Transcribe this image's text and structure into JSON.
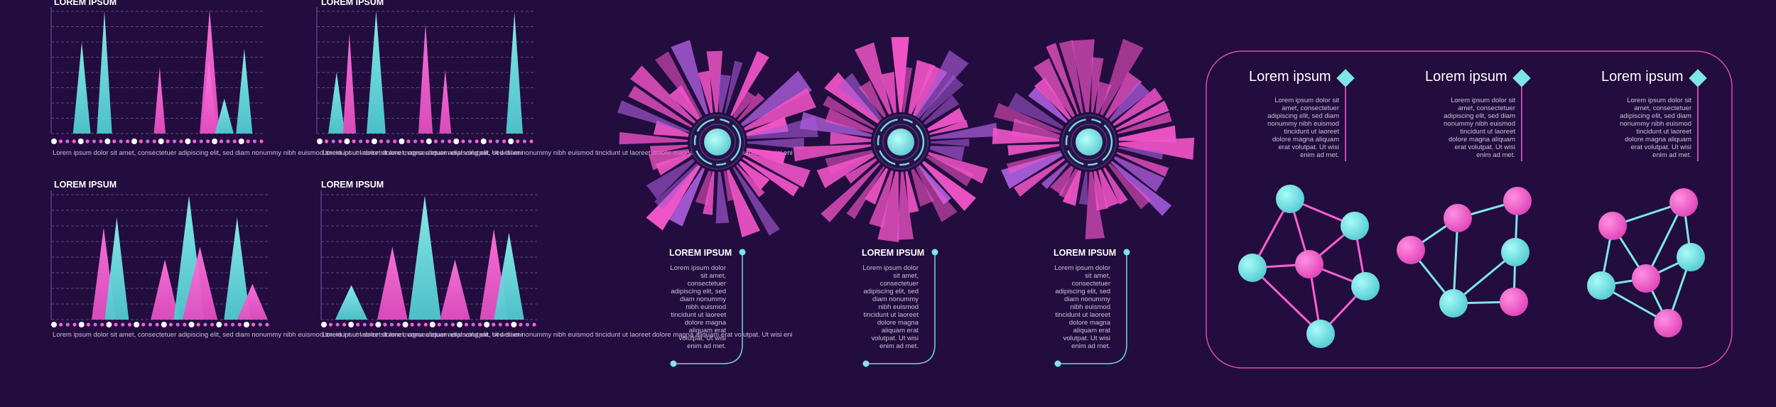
{
  "colors": {
    "background": "#230c3e",
    "cyan": "#7fe6e6",
    "magenta": "#ff5fcf",
    "grid": "#5a4a86",
    "panel_border": "#d64fb0"
  },
  "chart_data": [
    {
      "type": "area",
      "title": "LOREM IPSUM",
      "series": [
        {
          "name": "",
          "peaks": [
            {
              "c": 0.46,
              "h": 0.73,
              "w": 0.15,
              "color": "cyan"
            },
            {
              "c": 0.8,
              "h": 0.98,
              "w": 0.13,
              "color": "cyan"
            },
            {
              "c": 1.63,
              "h": 0.53,
              "w": 0.1,
              "color": "magenta"
            },
            {
              "c": 2.38,
              "h": 0.99,
              "w": 0.17,
              "color": "magenta"
            },
            {
              "c": 2.37,
              "h": 0.58,
              "w": 0.14,
              "color": "magenta"
            },
            {
              "c": 2.6,
              "h": 0.28,
              "w": 0.16,
              "color": "cyan"
            },
            {
              "c": 2.9,
              "h": 0.68,
              "w": 0.14,
              "color": "cyan"
            }
          ]
        }
      ],
      "caption": "Lorem ipsum dolor sit amet, consectetuer adipiscing elit, sed diam nonummy nibh euismod tincidunt ut laoreet dolore magna aliquam erat volutpat. Ut wisi eni"
    },
    {
      "type": "area",
      "title": "LOREM IPSUM",
      "series": [
        {
          "name": "",
          "peaks": [
            {
              "c": 0.2,
              "h": 0.49,
              "w": 0.14,
              "color": "cyan"
            },
            {
              "c": 0.33,
              "h": 0.8,
              "w": 0.11,
              "color": "magenta"
            },
            {
              "c": 0.6,
              "h": 0.98,
              "w": 0.16,
              "color": "cyan"
            },
            {
              "c": 1.1,
              "h": 0.88,
              "w": 0.12,
              "color": "magenta"
            },
            {
              "c": 1.3,
              "h": 0.51,
              "w": 0.1,
              "color": "magenta"
            },
            {
              "c": 2.0,
              "h": 0.97,
              "w": 0.14,
              "color": "cyan"
            }
          ]
        }
      ],
      "caption": "Lorem ipsum dolor sit amet, consectetuer adipiscing elit, sed diam nonummy nibh euismod tincidunt ut laoreet dolore magna aliquam erat volutpat. Ut wisi eni"
    },
    {
      "type": "area",
      "title": "LOREM IPSUM",
      "series": [
        {
          "name": "",
          "peaks": [
            {
              "c": 0.24,
              "h": 0.72,
              "w": 0.11,
              "color": "magenta"
            },
            {
              "c": 0.3,
              "h": 0.8,
              "w": 0.11,
              "color": "cyan"
            },
            {
              "c": 0.52,
              "h": 0.47,
              "w": 0.13,
              "color": "magenta"
            },
            {
              "c": 0.63,
              "h": 0.97,
              "w": 0.14,
              "color": "cyan"
            },
            {
              "c": 0.68,
              "h": 0.57,
              "w": 0.16,
              "color": "magenta"
            },
            {
              "c": 0.85,
              "h": 0.8,
              "w": 0.12,
              "color": "cyan"
            },
            {
              "c": 0.92,
              "h": 0.28,
              "w": 0.14,
              "color": "magenta"
            }
          ]
        }
      ],
      "caption": "Lorem ipsum dolor sit amet, consectetuer adipiscing elit, sed diam nonummy nibh euismod tincidunt ut laoreet dolore magna aliquam erat volutpat. Ut wisi eni"
    },
    {
      "type": "area",
      "title": "LOREM IPSUM",
      "series": [
        {
          "name": "",
          "peaks": [
            {
              "c": 0.14,
              "h": 0.27,
              "w": 0.15,
              "color": "cyan"
            },
            {
              "c": 0.33,
              "h": 0.57,
              "w": 0.14,
              "color": "magenta"
            },
            {
              "c": 0.48,
              "h": 0.97,
              "w": 0.15,
              "color": "cyan"
            },
            {
              "c": 0.62,
              "h": 0.47,
              "w": 0.14,
              "color": "magenta"
            },
            {
              "c": 0.8,
              "h": 0.71,
              "w": 0.13,
              "color": "magenta"
            },
            {
              "c": 0.87,
              "h": 0.68,
              "w": 0.14,
              "color": "cyan"
            }
          ]
        }
      ],
      "caption": "Lorem ipsum dolor sit amet, consectetuer adipiscing elit, sed diam nonummy nibh euismod tincidunt ut laoreet dolore magna aliquam erat volutpat. Ut wisi eni"
    }
  ],
  "radial_blocks": [
    {
      "title": "LOREM IPSUM",
      "lines": [
        "Lorem ipsum dolor",
        "sit amet,",
        "consectetuer",
        "adipiscing elit, sed",
        "diam nonummy",
        "nibh euismod",
        "tincidunt ut laoreet",
        "dolore magna",
        "aliquam erat",
        "volutpat. Ut wisi",
        "enim ad met."
      ]
    },
    {
      "title": "LOREM IPSUM",
      "lines": [
        "Lorem ipsum dolor",
        "sit amet,",
        "consectetuer",
        "adipiscing elit, sed",
        "diam nonummy",
        "nibh euismod",
        "tincidunt ut laoreet",
        "dolore magna",
        "aliquam erat",
        "volutpat. Ut wisi",
        "enim ad met."
      ]
    },
    {
      "title": "LOREM IPSUM",
      "lines": [
        "Lorem ipsum dolor",
        "sit amet,",
        "consectetuer",
        "adipiscing elit, sed",
        "diam nonummy",
        "nibh euismod",
        "tincidunt ut laoreet",
        "dolore magna",
        "aliquam erat",
        "volutpat. Ut wisi",
        "enim ad met."
      ]
    }
  ],
  "network_panel": {
    "columns": [
      {
        "heading": "Lorem ipsum",
        "lines": [
          "Lorem ipsum dolor sit",
          "amet, consectetuer",
          "adipiscing elit, sed diam",
          "nonummy nibh euismod",
          "tincidunt ut laoreet",
          "dolore magna aliquam",
          "erat volutpat. Ut wisi",
          "enim ad met."
        ]
      },
      {
        "heading": "Lorem ipsum",
        "lines": [
          "Lorem ipsum dolor sit",
          "amet, consectetuer",
          "adipiscing elit, sed diam",
          "nonummy nibh euismod",
          "tincidunt ut laoreet",
          "dolore magna aliquam",
          "erat volutpat. Ut wisi",
          "enim ad met."
        ]
      },
      {
        "heading": "Lorem ipsum",
        "lines": [
          "Lorem ipsum dolor sit",
          "amet, consectetuer",
          "adipiscing elit, sed diam",
          "nonummy nibh euismod",
          "tincidunt ut laoreet",
          "dolore magna aliquam",
          "erat volutpat. Ut wisi",
          "enim ad met."
        ]
      }
    ]
  }
}
